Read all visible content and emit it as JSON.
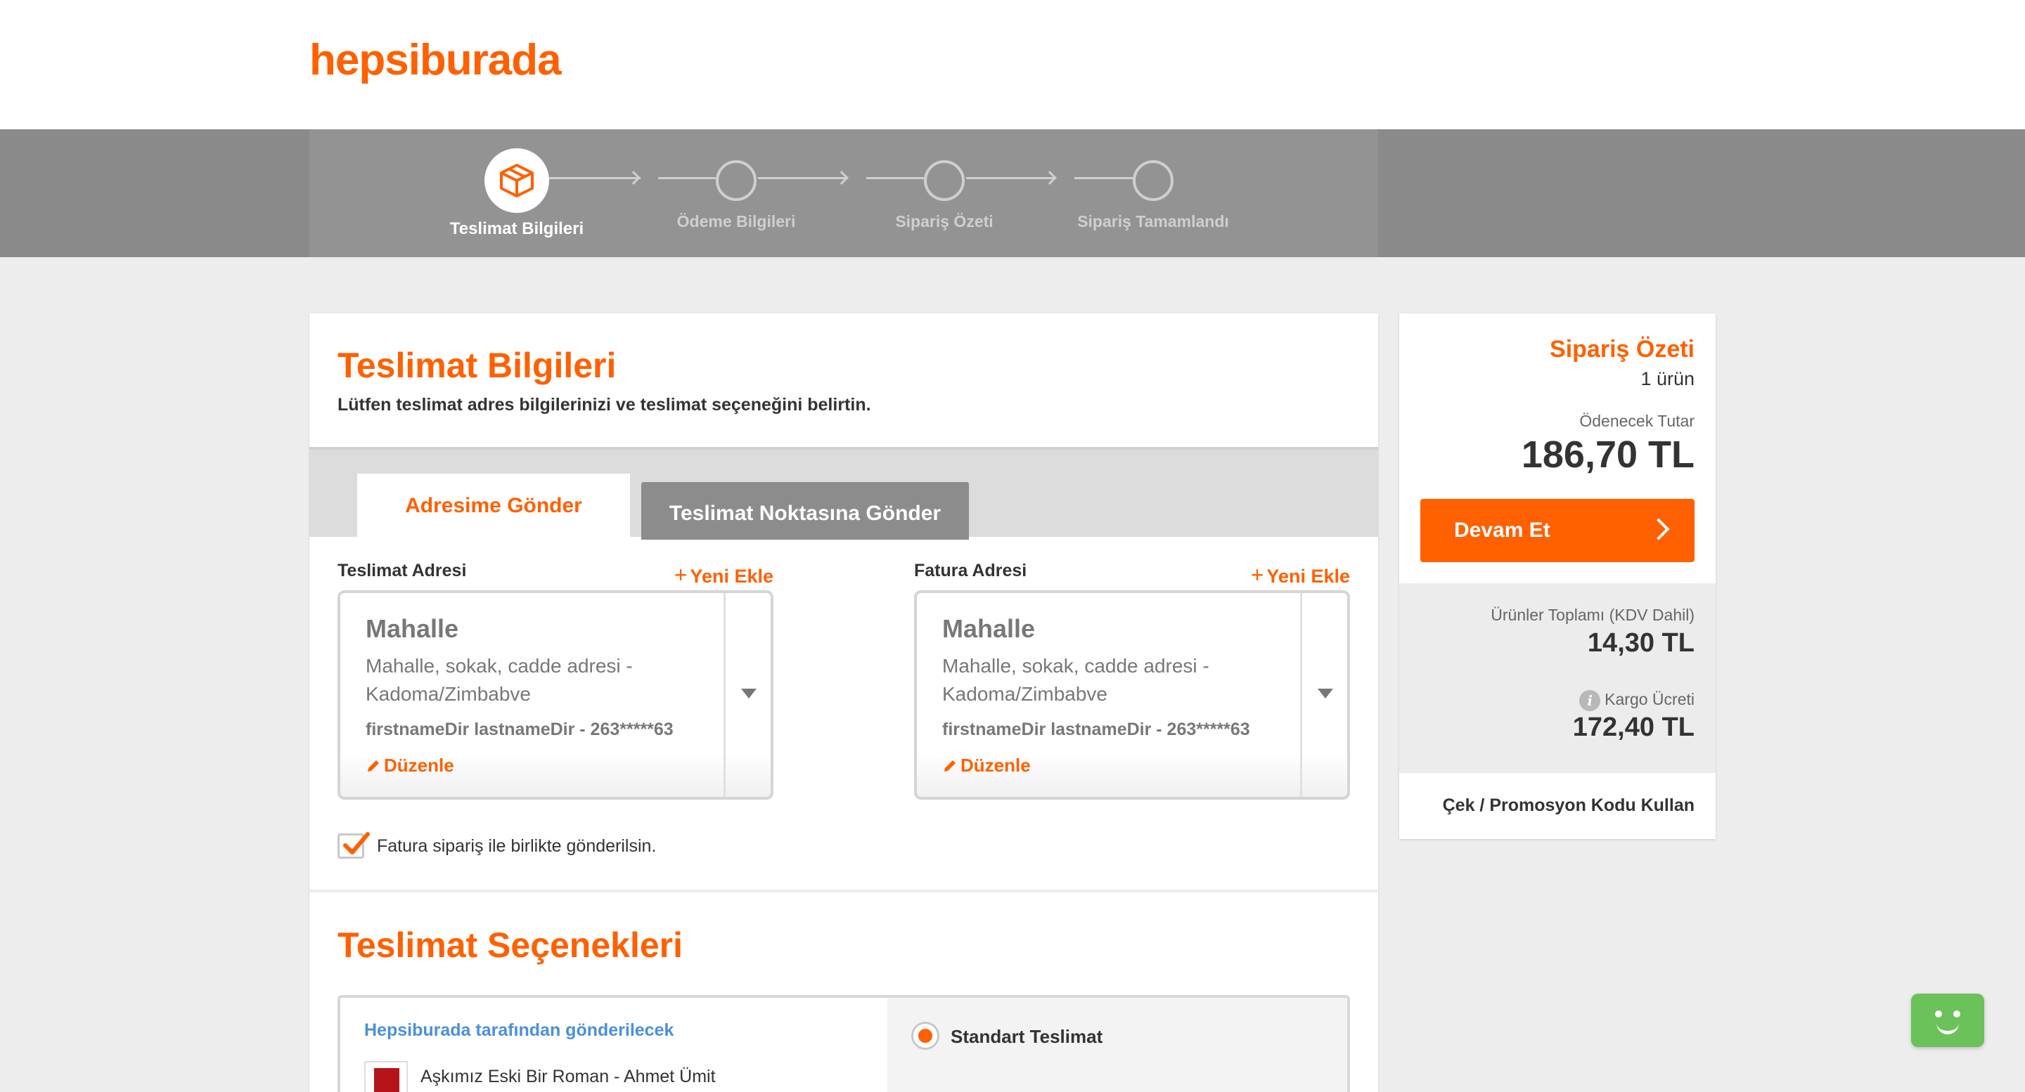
{
  "header": {
    "logo_text": "hepsiburada",
    "brand_color": "#ff6000"
  },
  "steps": [
    {
      "label": "Teslimat Bilgileri",
      "active": true,
      "icon": "box-icon"
    },
    {
      "label": "Ödeme Bilgileri",
      "active": false
    },
    {
      "label": "Sipariş Özeti",
      "active": false
    },
    {
      "label": "Sipariş Tamamlandı",
      "active": false
    }
  ],
  "main": {
    "title": "Teslimat Bilgileri",
    "subtitle": "Lütfen teslimat adres bilgilerinizi ve teslimat seçeneğini belirtin.",
    "tabs": [
      {
        "label": "Adresime Gönder",
        "active": true
      },
      {
        "label": "Teslimat Noktasına Gönder",
        "active": false
      }
    ],
    "shipping_address": {
      "label": "Teslimat Adresi",
      "add_new": "Yeni Ekle",
      "title": "Mahalle",
      "line1": "Mahalle, sokak, cadde adresi -",
      "line2": "Kadoma/Zimbabve",
      "person": "firstnameDir lastnameDir - 263*****63",
      "edit": "Düzenle"
    },
    "billing_address": {
      "label": "Fatura Adresi",
      "add_new": "Yeni Ekle",
      "title": "Mahalle",
      "line1": "Mahalle, sokak, cadde adresi -",
      "line2": "Kadoma/Zimbabve",
      "person": "firstnameDir lastnameDir - 263*****63",
      "edit": "Düzenle"
    },
    "invoice_checkbox": {
      "label": "Fatura sipariş ile birlikte gönderilsin.",
      "checked": true
    },
    "delivery_options": {
      "title": "Teslimat Seçenekleri",
      "seller": "Hepsiburada tarafından gönderilecek",
      "product_name": "Aşkımız Eski Bir Roman - Ahmet Ümit",
      "option_label": "Standart Teslimat",
      "option_selected": true
    }
  },
  "summary": {
    "title": "Sipariş Özeti",
    "item_count": "1 ürün",
    "pay_label": "Ödenecek Tutar",
    "pay_value": "186,70 TL",
    "continue_label": "Devam Et",
    "products_label": "Ürünler Toplamı (KDV Dahil)",
    "products_value": "14,30 TL",
    "cargo_label": "Kargo Ücreti",
    "cargo_value": "172,40 TL",
    "promo_label": "Çek / Promosyon Kodu Kullan"
  }
}
